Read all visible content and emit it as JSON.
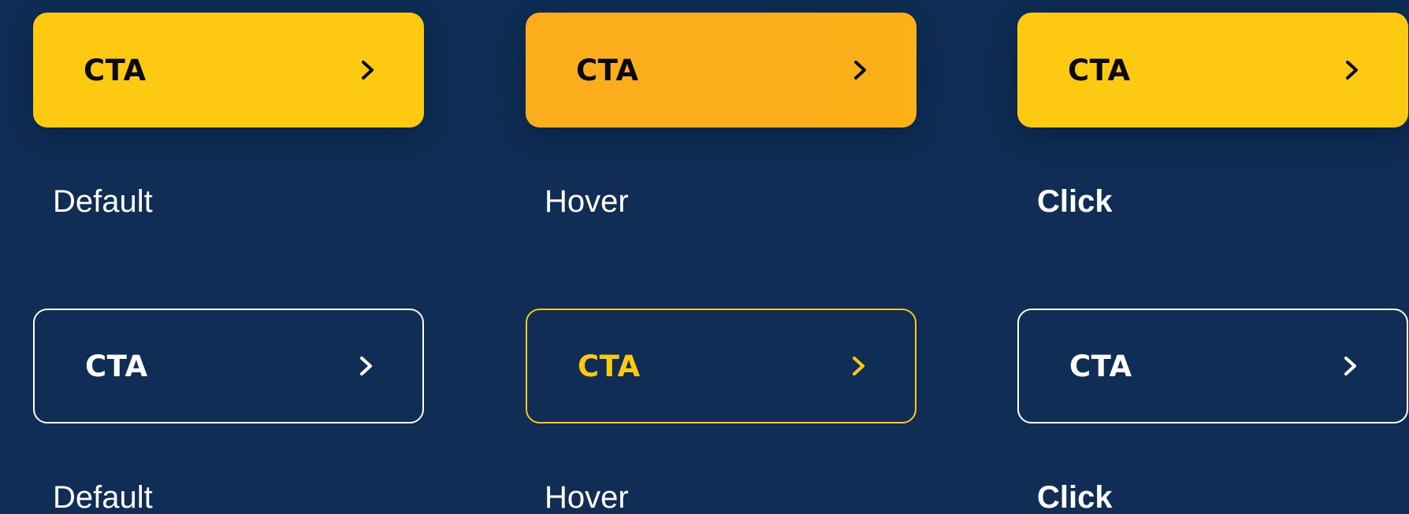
{
  "colors": {
    "background": "#0f2d55",
    "primary_yellow": "#fdc911",
    "hover_orange": "#fbad1b",
    "outline_white": "#ffffff",
    "text_dark": "#0a0a0a"
  },
  "primary_row": {
    "default": {
      "label": "CTA",
      "icon": "chevron-right-icon",
      "state_label": "Default"
    },
    "hover": {
      "label": "CTA",
      "icon": "chevron-right-icon",
      "state_label": "Hover"
    },
    "click": {
      "label": "CTA",
      "icon": "chevron-right-icon",
      "state_label": "Click"
    }
  },
  "secondary_row": {
    "default": {
      "label": "CTA",
      "icon": "chevron-right-icon",
      "state_label": "Default"
    },
    "hover": {
      "label": "CTA",
      "icon": "chevron-right-icon",
      "state_label": "Hover"
    },
    "click": {
      "label": "CTA",
      "icon": "chevron-right-icon",
      "state_label": "Click"
    }
  }
}
